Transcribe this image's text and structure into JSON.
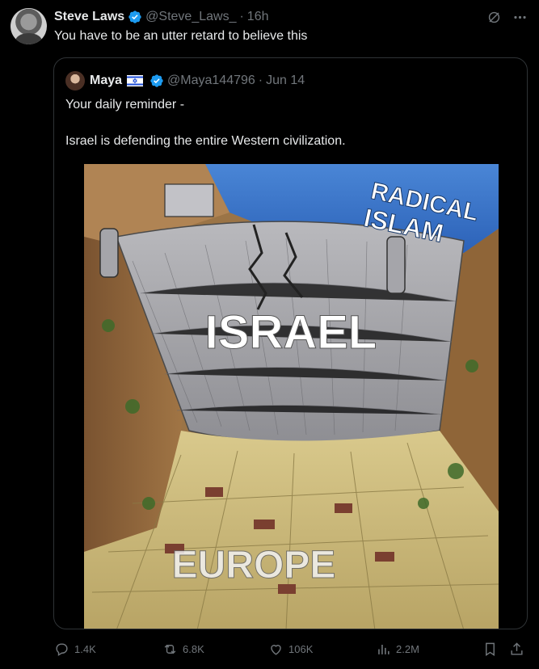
{
  "post": {
    "author_name": "Steve Laws",
    "handle": "@Steve_Laws_",
    "separator": "·",
    "time": "16h",
    "text": "You have to be an utter retard to believe this"
  },
  "quote": {
    "author_name": "Maya",
    "handle": "@Maya144796",
    "separator": "·",
    "time": "Jun 14",
    "line1": "Your daily reminder -",
    "line2": "Israel is defending the entire Western civilization.",
    "image": {
      "label_top": "RADICAL",
      "label_top2": "ISLAM",
      "label_dam": "ISRAEL",
      "label_bottom": "EUROPE"
    }
  },
  "actions": {
    "replies": "1.4K",
    "reposts": "6.8K",
    "likes": "106K",
    "views": "2.2M"
  },
  "colors": {
    "background": "#000000",
    "text": "#e7e9ea",
    "muted": "#71767b",
    "verified": "#1d9bf0",
    "border": "#2f3336"
  },
  "icons": [
    "verified-badge-icon",
    "grok-icon",
    "more-icon",
    "israel-flag-icon",
    "reply-icon",
    "repost-icon",
    "like-icon",
    "views-icon",
    "bookmark-icon",
    "share-icon"
  ]
}
